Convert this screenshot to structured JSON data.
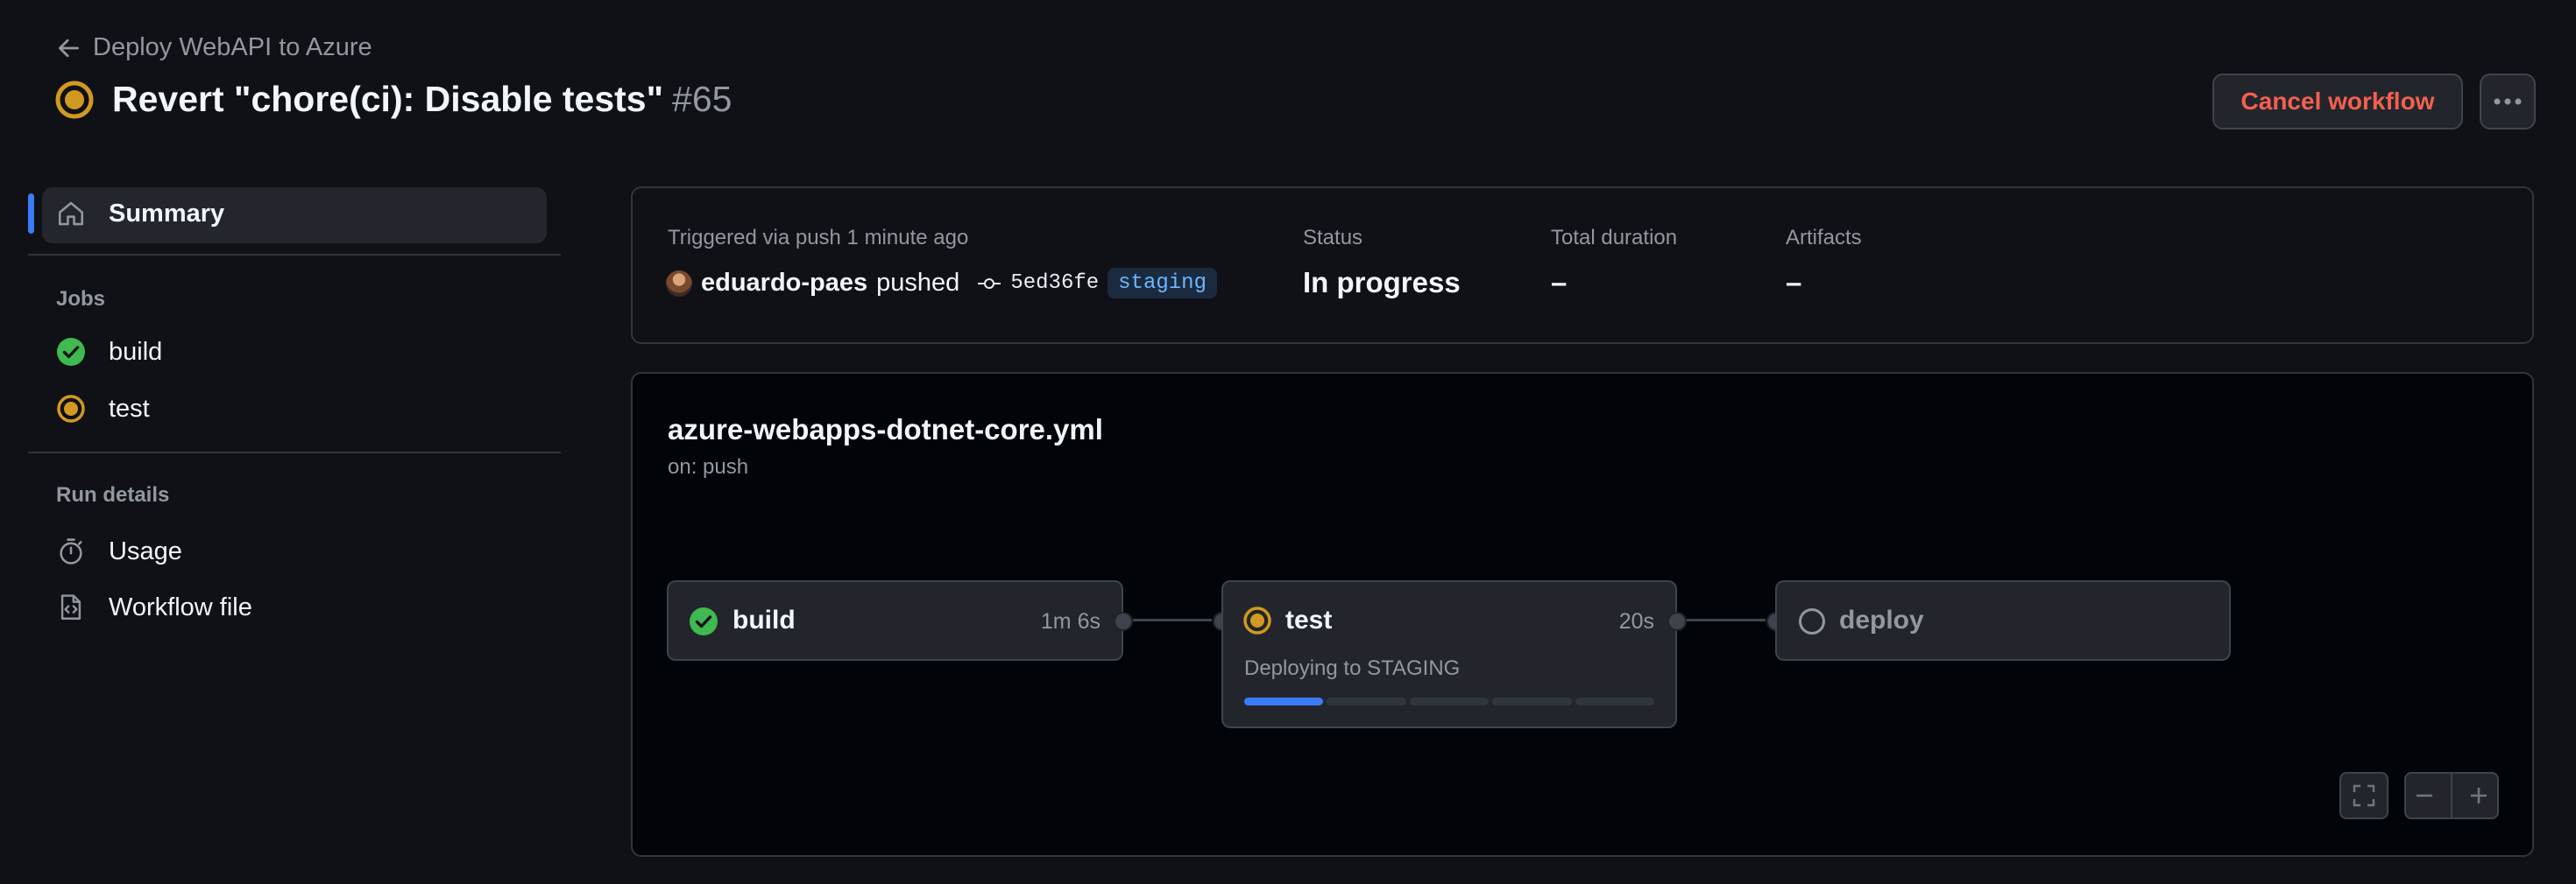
{
  "header": {
    "back_label": "Deploy WebAPI to Azure",
    "title": "Revert \"chore(ci): Disable tests\"",
    "run_number": "#65",
    "cancel_label": "Cancel workflow"
  },
  "sidebar": {
    "summary_label": "Summary",
    "jobs_heading": "Jobs",
    "jobs": [
      {
        "label": "build",
        "status": "success"
      },
      {
        "label": "test",
        "status": "in_progress"
      }
    ],
    "run_details_heading": "Run details",
    "usage_label": "Usage",
    "workflow_file_label": "Workflow file"
  },
  "summary": {
    "trigger_text": "Triggered via push 1 minute ago",
    "actor": "eduardo-paes",
    "action": "pushed",
    "commit": "5ed36fe",
    "branch": "staging",
    "status_label": "Status",
    "status_value": "In progress",
    "duration_label": "Total duration",
    "duration_value": "–",
    "artifacts_label": "Artifacts",
    "artifacts_value": "–"
  },
  "workflow": {
    "file": "azure-webapps-dotnet-core.yml",
    "trigger": "on: push",
    "jobs": [
      {
        "name": "build",
        "time": "1m 6s",
        "status": "success"
      },
      {
        "name": "test",
        "time": "20s",
        "status": "in_progress",
        "step": "Deploying to STAGING",
        "progress_fraction": 0.2
      },
      {
        "name": "deploy",
        "time": "",
        "status": "queued"
      }
    ]
  },
  "colors": {
    "success": "#3fb950",
    "in_progress": "#d29922",
    "accent": "#3a7cf6",
    "danger": "#f4604f"
  }
}
